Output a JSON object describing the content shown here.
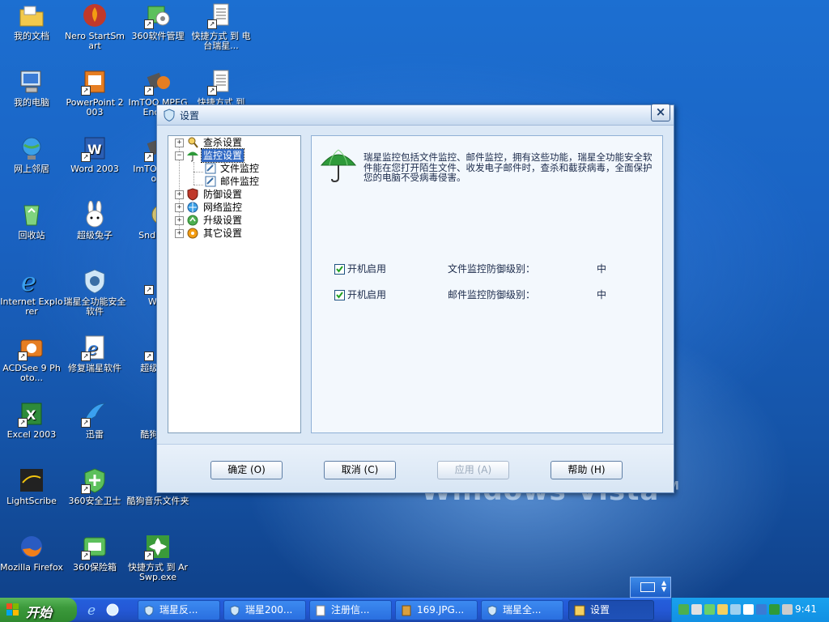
{
  "wallpaper": {
    "brand": "Windows Vista",
    "brand_sup": "TM"
  },
  "desktop_icons": [
    {
      "label": "我的文档"
    },
    {
      "label": "Nero StartSmart"
    },
    {
      "label": "360软件管理"
    },
    {
      "label": "快捷方式 到 电台瑞星..."
    },
    {
      "label": "我的电脑"
    },
    {
      "label": "PowerPoint 2003"
    },
    {
      "label": "ImTOO MPEG Enco..."
    },
    {
      "label": "快捷方式 到"
    },
    {
      "label": "网上邻居"
    },
    {
      "label": "Word 2003"
    },
    {
      "label": "ImTOO Enco..."
    },
    {
      "label": "回收站"
    },
    {
      "label": "超级兔子"
    },
    {
      "label": "SndMa..."
    },
    {
      "label": "Internet Explorer"
    },
    {
      "label": "瑞星全功能安全软件"
    },
    {
      "label": "Wi..."
    },
    {
      "label": "ACDSee 9 Photo..."
    },
    {
      "label": "修复瑞星软件"
    },
    {
      "label": "超级解..."
    },
    {
      "label": "Excel 2003"
    },
    {
      "label": "迅雷"
    },
    {
      "label": "酷狗音..."
    },
    {
      "label": "LightScribe"
    },
    {
      "label": "360安全卫士"
    },
    {
      "label": "酷狗音乐文件夹"
    },
    {
      "label": "Mozilla Firefox"
    },
    {
      "label": "360保险箱"
    },
    {
      "label": "快捷方式 到 ArSwp.exe"
    }
  ],
  "dialog": {
    "title": "设置",
    "close_glyph": "×",
    "tree": [
      {
        "label": "查杀设置",
        "expander": "+"
      },
      {
        "label": "监控设置",
        "expander": "−",
        "selected": true
      },
      {
        "label": "文件监控"
      },
      {
        "label": "邮件监控"
      },
      {
        "label": "防御设置",
        "expander": "+"
      },
      {
        "label": "网络监控",
        "expander": "+"
      },
      {
        "label": "升级设置",
        "expander": "+"
      },
      {
        "label": "其它设置",
        "expander": "+"
      }
    ],
    "description": "瑞星监控包括文件监控、邮件监控，拥有这些功能，瑞星全功能安全软件能在您打开陌生文件、收发电子邮件时，查杀和截获病毒，全面保护您的电脑不受病毒侵害。",
    "options": [
      {
        "enable_label": "开机启用",
        "checked": true,
        "level_label": "文件监控防御级别：",
        "level": "中"
      },
      {
        "enable_label": "开机启用",
        "checked": true,
        "level_label": "邮件监控防御级别：",
        "level": "中"
      }
    ],
    "buttons": {
      "ok": "确定 (O)",
      "cancel": "取消 (C)",
      "apply": "应用 (A)",
      "help": "帮助 (H)"
    }
  },
  "taskbar": {
    "start_label": "开始",
    "tasks": [
      {
        "label": "瑞星反..."
      },
      {
        "label": "瑞星200..."
      },
      {
        "label": "注册信..."
      },
      {
        "label": "169.JPG..."
      },
      {
        "label": "瑞星全..."
      },
      {
        "label": "设置",
        "active": true
      }
    ],
    "clock": "9:41"
  },
  "colors": {
    "desktop": "#1a63c3",
    "taskbar": "#245edb",
    "start": "#3c9a3c",
    "tray": "#1290e3",
    "selection": "#316ac5"
  }
}
